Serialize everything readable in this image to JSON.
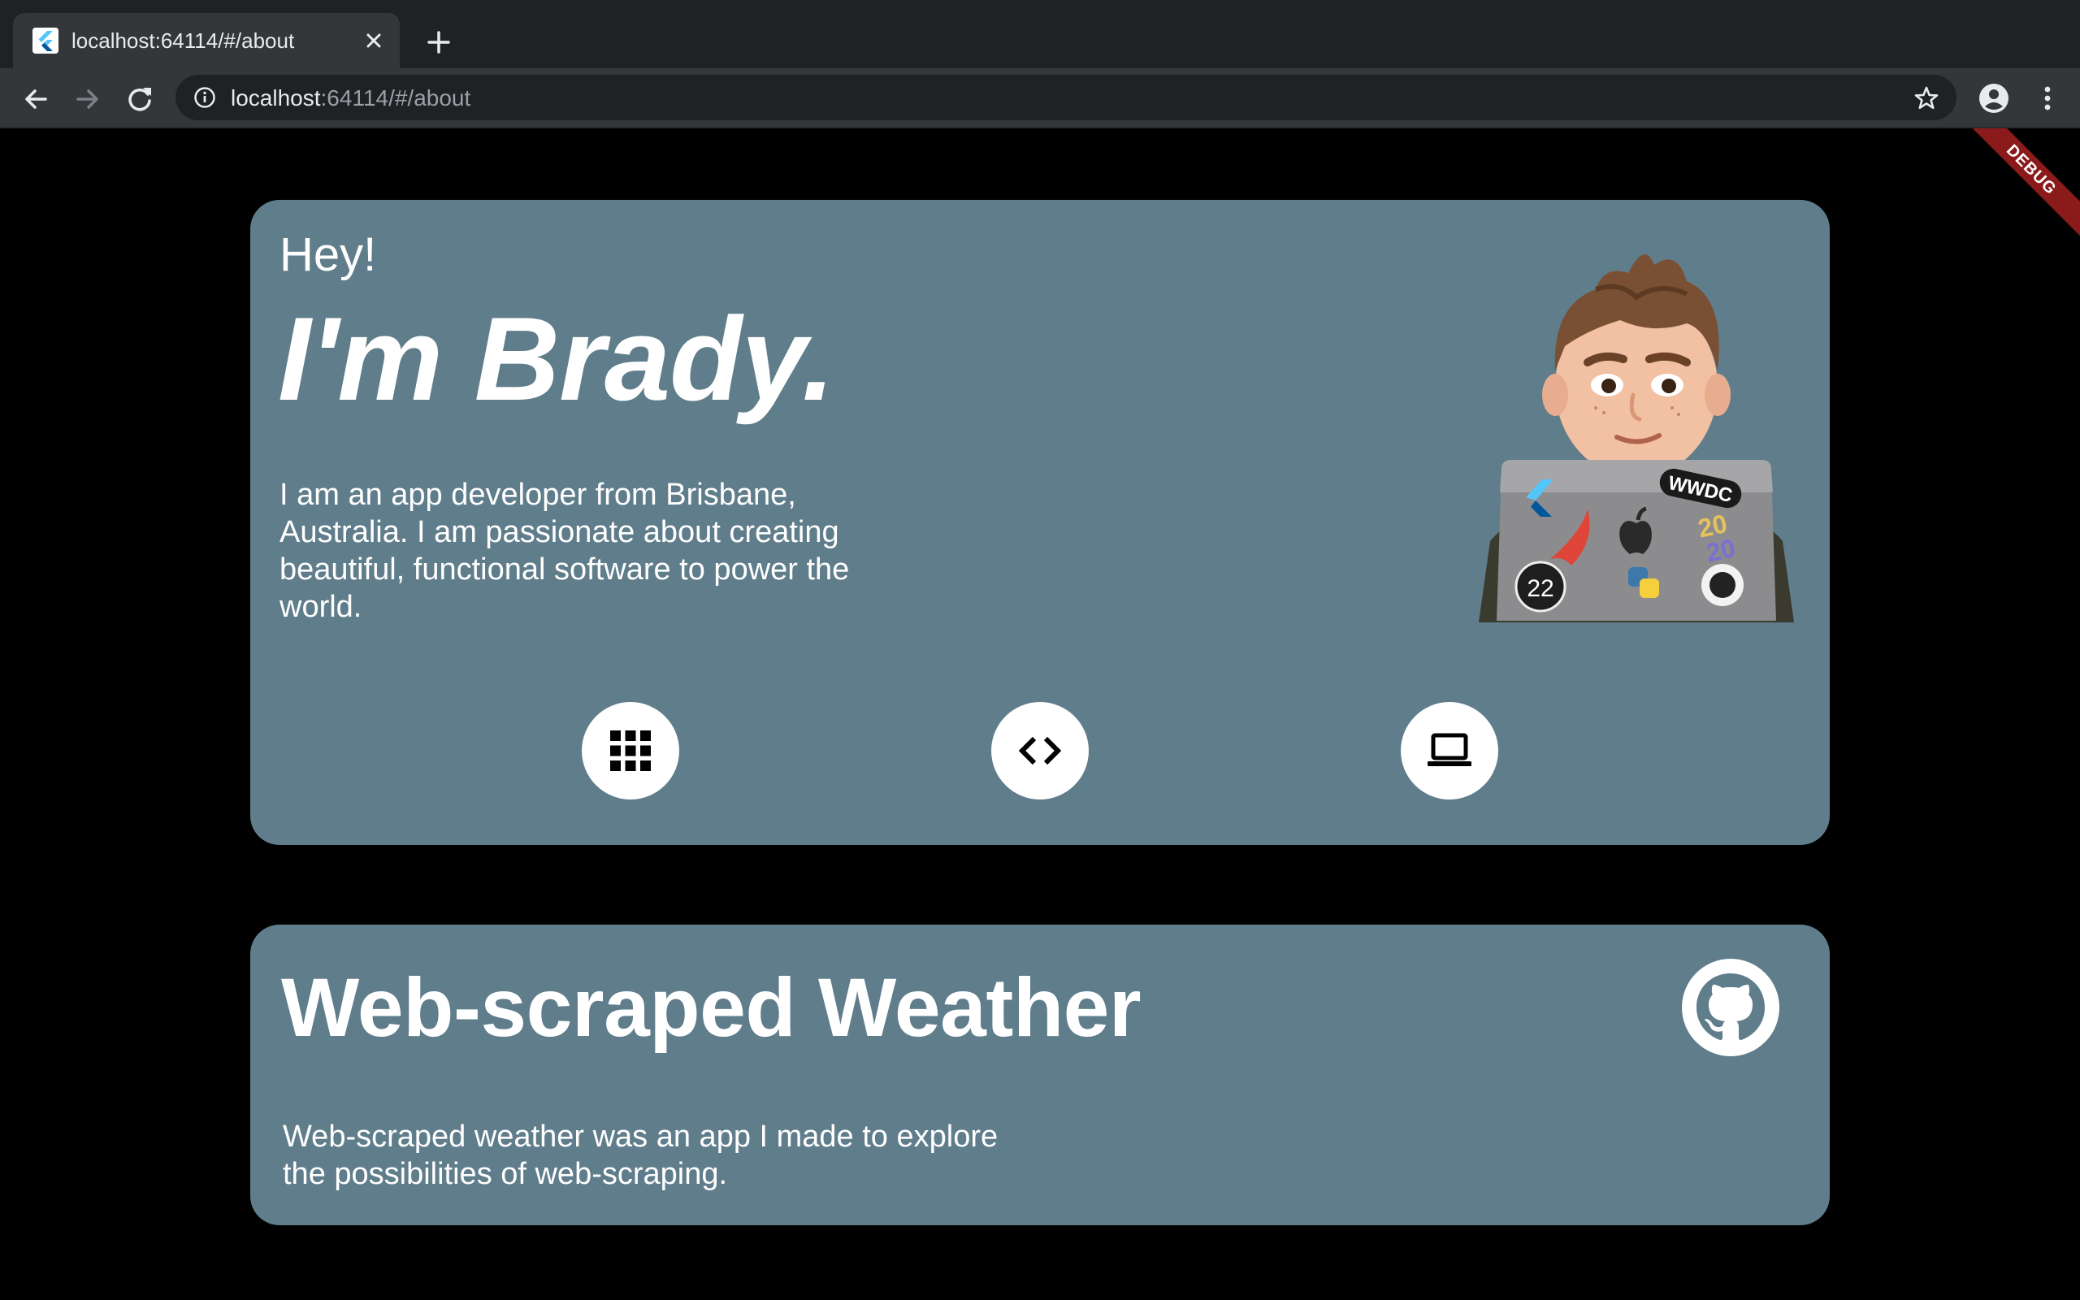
{
  "browser": {
    "tab_title": "localhost:64114/#/about",
    "url_host": "localhost",
    "url_rest": ":64114/#/about"
  },
  "debug_banner": "DEBUG",
  "about": {
    "greeting": "Hey!",
    "name": "I'm Brady.",
    "bio": "I am an app developer from Brisbane, Australia. I am passionate about creating beautiful, functional software to power the world.",
    "buttons": [
      "apps-grid-icon",
      "code-icon",
      "laptop-icon"
    ],
    "laptop_stickers": [
      "WWDC",
      "20",
      "20",
      "22"
    ]
  },
  "project": {
    "title": "Web-scraped Weather",
    "description": "Web-scraped weather was an app I made to explore the possibilities of web-scraping."
  },
  "colors": {
    "card": "#607d8b",
    "background": "#000000",
    "debug": "#8b1a1a"
  }
}
